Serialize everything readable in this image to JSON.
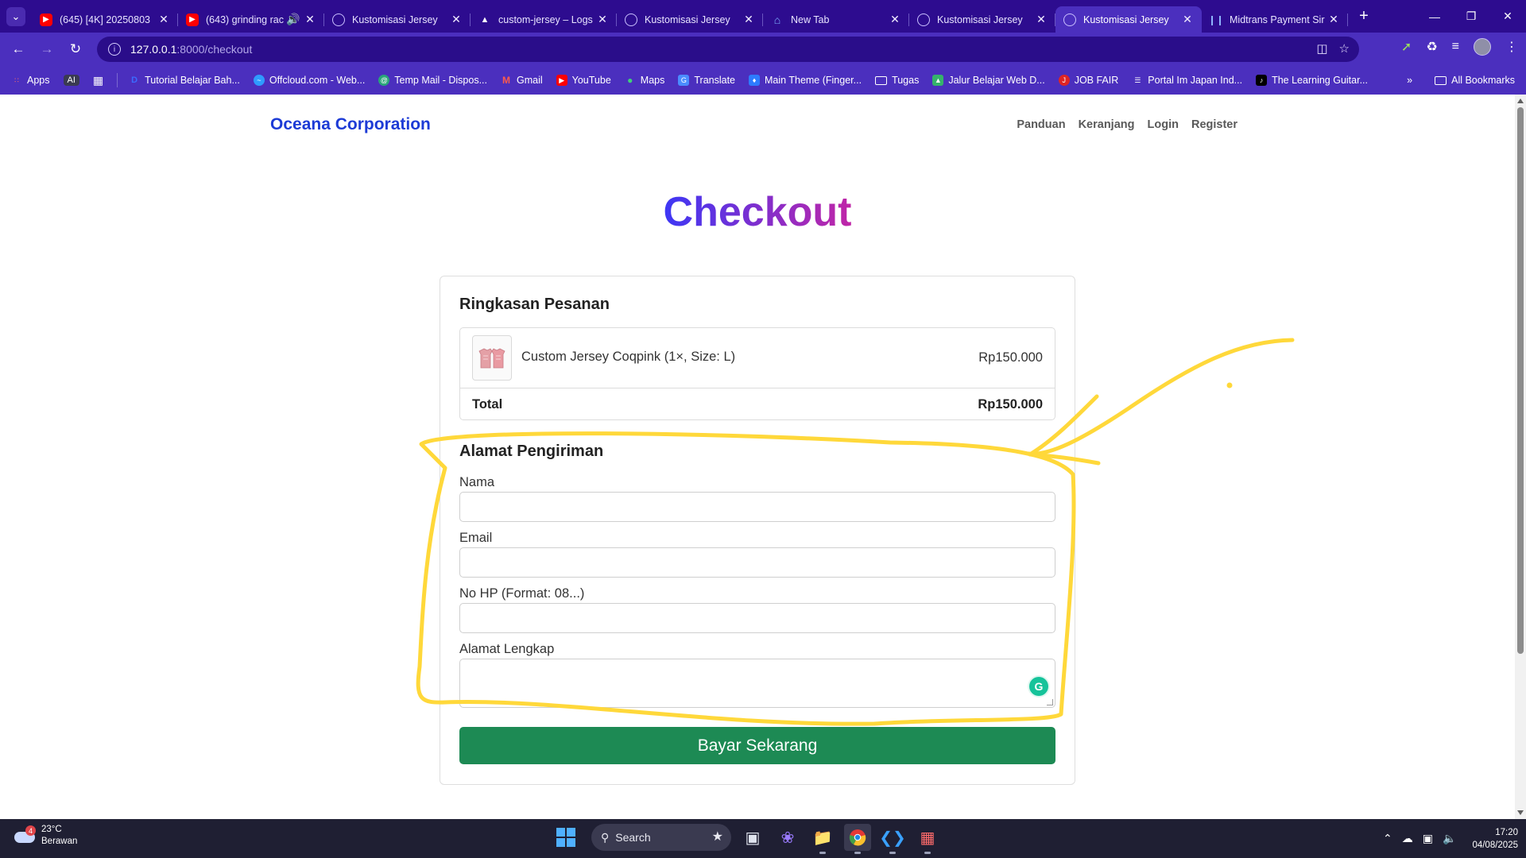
{
  "browser": {
    "tabs": [
      {
        "title": "(645) [4K] 20250803 ",
        "favicon": "youtube-icon",
        "active": false
      },
      {
        "title": "(643) grinding rac",
        "favicon": "youtube-icon",
        "active": false,
        "audio": true
      },
      {
        "title": "Kustomisasi Jersey",
        "favicon": "globe-icon",
        "active": false
      },
      {
        "title": "custom-jersey – Logs",
        "favicon": "vercel-icon",
        "active": false
      },
      {
        "title": "Kustomisasi Jersey",
        "favicon": "globe-icon",
        "active": false
      },
      {
        "title": "New Tab",
        "favicon": "home-icon",
        "active": false
      },
      {
        "title": "Kustomisasi Jersey",
        "favicon": "globe-icon",
        "active": false
      },
      {
        "title": "Kustomisasi Jersey",
        "favicon": "globe-icon",
        "active": true
      },
      {
        "title": "Midtrans Payment Sir",
        "favicon": "midtrans-icon",
        "active": false
      }
    ],
    "url_host": "127.0.0.1",
    "url_rest": ":8000/checkout",
    "bookmarks": [
      {
        "label": "Apps",
        "icon": "apps-grid-icon"
      },
      {
        "label": "Tutorial Belajar Bah...",
        "icon": "d-icon"
      },
      {
        "label": "Offcloud.com - Web...",
        "icon": "offcloud-icon"
      },
      {
        "label": "Temp Mail - Dispos...",
        "icon": "tempmail-icon"
      },
      {
        "label": "Gmail",
        "icon": "gmail-icon"
      },
      {
        "label": "YouTube",
        "icon": "youtube-icon"
      },
      {
        "label": "Maps",
        "icon": "maps-icon"
      },
      {
        "label": "Translate",
        "icon": "translate-icon"
      },
      {
        "label": "Main Theme (Finger...",
        "icon": "theme-icon"
      },
      {
        "label": "Tugas",
        "icon": "folder-icon"
      },
      {
        "label": "Jalur Belajar Web D...",
        "icon": "jalur-icon"
      },
      {
        "label": "JOB FAIR",
        "icon": "jobfair-icon"
      },
      {
        "label": "Portal Im Japan Ind...",
        "icon": "portal-icon"
      },
      {
        "label": "The Learning Guitar...",
        "icon": "guitar-icon"
      }
    ],
    "bookmark_ai": "AI",
    "all_bookmarks": "All Bookmarks"
  },
  "site": {
    "brand": "Oceana Corporation",
    "nav": [
      "Panduan",
      "Keranjang",
      "Login",
      "Register"
    ]
  },
  "page": {
    "title": "Checkout",
    "title_gradient": [
      "#3d37f5",
      "#c026a7"
    ]
  },
  "summary": {
    "title": "Ringkasan Pesanan",
    "items": [
      {
        "name": "Custom Jersey Coqpink (1×, Size: L)",
        "price": "Rp150.000"
      }
    ],
    "total_label": "Total",
    "total_value": "Rp150.000"
  },
  "shipping": {
    "title": "Alamat Pengiriman",
    "fields": [
      {
        "label": "Nama",
        "value": ""
      },
      {
        "label": "Email",
        "value": ""
      },
      {
        "label": "No HP (Format: 08...)",
        "value": ""
      },
      {
        "label": "Alamat Lengkap",
        "value": ""
      }
    ]
  },
  "pay_button": "Bayar Sekarang",
  "colors": {
    "brand": "#1d3bd6",
    "pay_button": "#1d8a54",
    "annotation": "#ffd83a",
    "chrome": "#4b2fbe"
  },
  "taskbar": {
    "weather_temp": "23°C",
    "weather_desc": "Berawan",
    "weather_badge": "4",
    "search_label": "Search",
    "time": "17:20",
    "date": "04/08/2025"
  }
}
